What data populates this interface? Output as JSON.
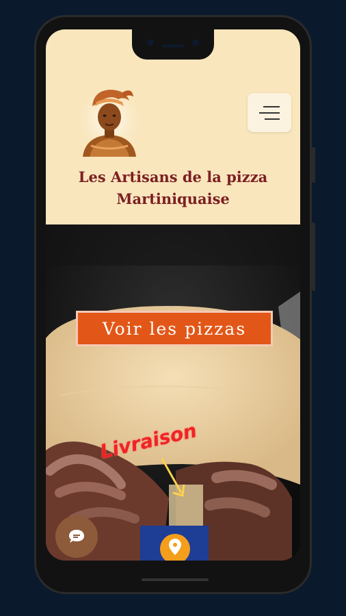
{
  "site": {
    "title_line1": "Les Artisans de la pizza",
    "title_line2": "Martiniquaise"
  },
  "hero": {
    "cta_label": "Voir les pizzas",
    "overlay_text": "Livraison"
  },
  "icons": {
    "menu": "hamburger-menu-icon",
    "chat": "chat-bubble-icon",
    "location": "location-pin-icon",
    "logo": "woman-headwrap-logo"
  },
  "colors": {
    "header_bg": "#f9e6bd",
    "title": "#7b1f22",
    "cta": "#e25718",
    "livraison": "#ef2424",
    "location_box": "#1e3d94",
    "location_pin": "#f59e1b",
    "chat": "#8d5a3a"
  }
}
